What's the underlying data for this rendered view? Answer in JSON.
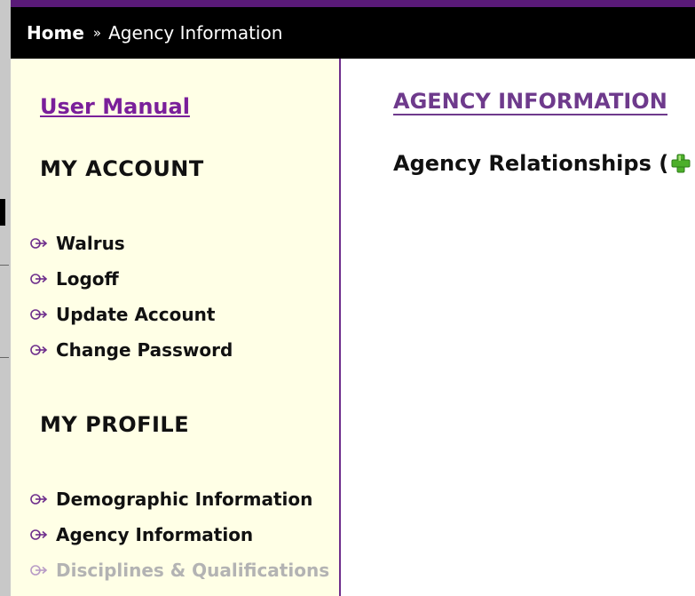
{
  "breadcrumb": {
    "home": "Home",
    "separator": "»",
    "current": "Agency Information"
  },
  "sidebar": {
    "user_manual": "User Manual",
    "my_account": {
      "title": "MY ACCOUNT",
      "items": [
        {
          "label": "Walrus",
          "icon": "arrow-right-icon"
        },
        {
          "label": "Logoff",
          "icon": "arrow-right-icon"
        },
        {
          "label": "Update Account",
          "icon": "arrow-right-icon"
        },
        {
          "label": "Change Password",
          "icon": "arrow-right-icon"
        }
      ]
    },
    "my_profile": {
      "title": "MY PROFILE",
      "items": [
        {
          "label": "Demographic Information",
          "icon": "arrow-right-icon"
        },
        {
          "label": "Agency Information",
          "icon": "arrow-right-icon"
        },
        {
          "label": "Disciplines & Qualifications",
          "icon": "arrow-right-icon",
          "disabled": true
        }
      ]
    }
  },
  "main": {
    "title": "AGENCY INFORMATION",
    "relationships_label": "Agency Relationships (",
    "relationships_close": ")",
    "add_icon": "plus-icon"
  },
  "colors": {
    "header_bg": "#000000",
    "accent_purple": "#5a1a78",
    "sidebar_bg": "#ffffe6",
    "link_purple": "#7a1f9a",
    "disabled_text": "#b3b3b3",
    "add_green": "#4caf2a"
  }
}
